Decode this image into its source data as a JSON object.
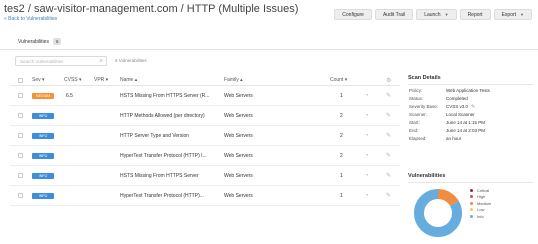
{
  "header": {
    "title": "tes2 / saw-visitor-management.com / HTTP (Multiple Issues)",
    "back_link": "« Back to Vulnerabilities"
  },
  "toolbar": {
    "configure": "Configure",
    "audit_trail": "Audit Trail",
    "launch": "Launch",
    "report": "Report",
    "export": "Export"
  },
  "tabs": [
    {
      "label": "Vulnerabilities",
      "count": "6"
    }
  ],
  "search": {
    "placeholder": "Search Vulnerabilities",
    "result_count": "6 Vulnerabilities"
  },
  "table": {
    "headers": {
      "sev": "Sev",
      "cvss": "CVSS",
      "vpr": "VPR",
      "name": "Name",
      "family": "Family",
      "count": "Count"
    },
    "rows": [
      {
        "sev": "MEDIUM",
        "sev_level": "medium",
        "cvss": "6.5",
        "vpr": "",
        "name": "HSTS Missing From HTTPS Server (R...",
        "family": "Web Servers",
        "count": "1"
      },
      {
        "sev": "INFO",
        "sev_level": "info",
        "cvss": "",
        "vpr": "",
        "name": "HTTP Methods Allowed (per directory)",
        "family": "Web Servers",
        "count": "2"
      },
      {
        "sev": "INFO",
        "sev_level": "info",
        "cvss": "",
        "vpr": "",
        "name": "HTTP Server Type and Version",
        "family": "Web Servers",
        "count": "2"
      },
      {
        "sev": "INFO",
        "sev_level": "info",
        "cvss": "",
        "vpr": "",
        "name": "HyperText Transfer Protocol (HTTP) I...",
        "family": "Web Servers",
        "count": "2"
      },
      {
        "sev": "INFO",
        "sev_level": "info",
        "cvss": "",
        "vpr": "",
        "name": "HSTS Missing From HTTPS Server",
        "family": "Web Servers",
        "count": "1"
      },
      {
        "sev": "INFO",
        "sev_level": "info",
        "cvss": "",
        "vpr": "",
        "name": "HyperText Transfer Protocol (HTTP)...",
        "family": "Web Servers",
        "count": "1"
      }
    ]
  },
  "scan_details": {
    "title": "Scan Details",
    "rows": [
      {
        "key": "Policy:",
        "value": "Web Application Tests"
      },
      {
        "key": "Status:",
        "value": "Completed"
      },
      {
        "key": "Severity Base:",
        "value": "CVSS v3.0"
      },
      {
        "key": "Scanner:",
        "value": "Local Scanner"
      },
      {
        "key": "Start:",
        "value": "June 14 at 1:15 PM"
      },
      {
        "key": "End:",
        "value": "June 14 at 2:03 PM"
      },
      {
        "key": "Elapsed:",
        "value": "an hour"
      }
    ]
  },
  "vulnerabilities_panel": {
    "title": "Vulnerabilities",
    "legend": [
      {
        "label": "Critical",
        "color": "#91243e"
      },
      {
        "label": "High",
        "color": "#dd4b50"
      },
      {
        "label": "Medium",
        "color": "#f18c43"
      },
      {
        "label": "Low",
        "color": "#f8c851"
      },
      {
        "label": "Info",
        "color": "#67acdf"
      }
    ],
    "donut": [
      {
        "label": "Medium",
        "value": 1,
        "color": "#f18c43"
      },
      {
        "label": "Info",
        "value": 5,
        "color": "#67acdf"
      }
    ]
  }
}
